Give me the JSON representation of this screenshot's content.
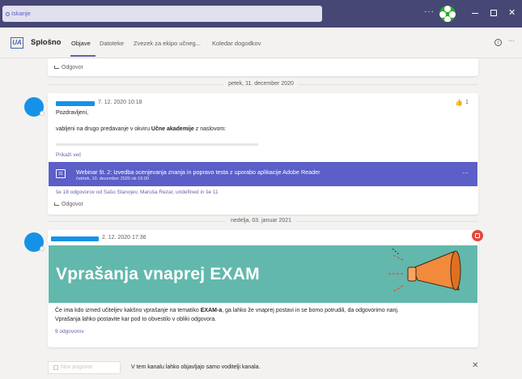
{
  "search": {
    "placeholder": "Iskanje"
  },
  "titlebar": {
    "more": "···",
    "close": "✕"
  },
  "channel": {
    "logo_text": "UA",
    "name": "Splošno",
    "tabs": [
      "Objave",
      "Datoteke",
      "Zvezek za ekipo učneg...",
      "Koledar dogodkov"
    ],
    "info": "i",
    "more": "···"
  },
  "feed": {
    "top_reply": "Odgovor",
    "date1": "petek, 11. december 2020",
    "post1": {
      "timestamp": "7. 12. 2020 10:18",
      "reaction": "👍",
      "reaction_count": "1",
      "greeting": "Pozdravljeni,",
      "line_pre": "vabljeni na drugo predavanje v okviru ",
      "line_bold": "Učne akademije",
      "line_post": " z naslovom:",
      "see_more": "Prikaži več",
      "event_title": "Webinar št. 2: Izvedba ocenjevanja znanja in popravo testa z uporabo aplikacije Adobe Reader",
      "event_time": "četrtek, 10. december 2020 ob 16:00",
      "event_more": "···",
      "replies_summary": "še 18 odgovorov od Sašo Stanojev, Maruša Rezar, undefined in še 11",
      "reply": "Odgovor"
    },
    "date2": "nedelja, 03. januar 2021",
    "post2": {
      "timestamp": "2. 12. 2020 17:36",
      "image_title": "Vprašanja vnaprej EXAM",
      "text1_pre": "Če ima kdo izmed učiteljev kakšno vprašanje na tematiko ",
      "text1_bold": "EXAM-a",
      "text1_post": ", ga lahko že vnaprej postavi in se bomo potrudili, da odgovorimo nanj.",
      "text2": "Vprašanja lahko postavite kar pod to obvestilo v obliki odgovora.",
      "replies": "9 odgovorov"
    }
  },
  "composer": {
    "new_post": "Nov pogovor",
    "note": "V tem kanalu lahko objavljajo samo voditelji kanala.",
    "close": "✕"
  },
  "colors": {
    "titlebar": "#464775",
    "accent": "#6264a7",
    "banner": "#5b5fc7",
    "exam_bg": "#62b8ac",
    "megaphone": "#f28a3c"
  }
}
